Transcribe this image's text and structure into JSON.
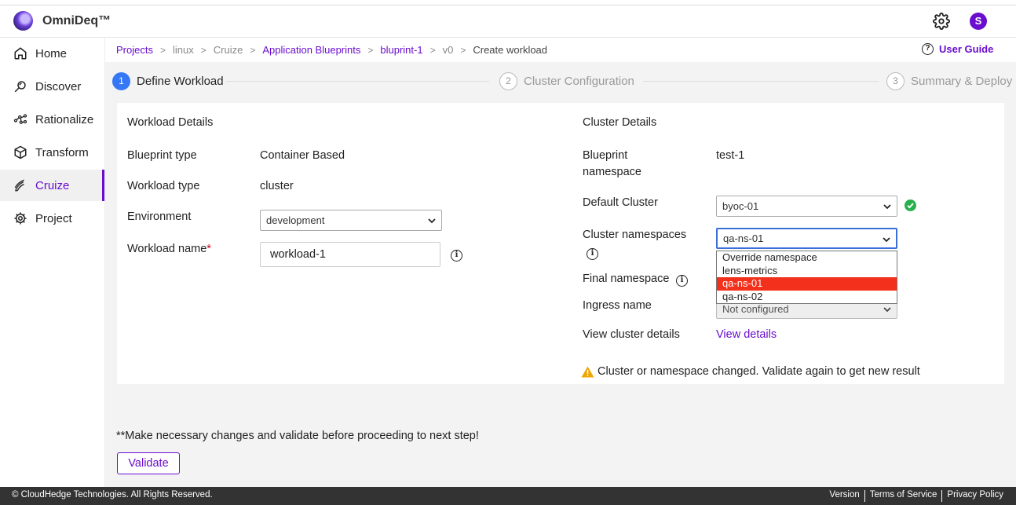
{
  "app": {
    "brand": "OmniDeq™",
    "avatar_initial": "S",
    "accent": "#6a0dce"
  },
  "sidebar": {
    "items": [
      {
        "label": "Home",
        "icon": "home-icon"
      },
      {
        "label": "Discover",
        "icon": "discover-icon"
      },
      {
        "label": "Rationalize",
        "icon": "rationalize-icon"
      },
      {
        "label": "Transform",
        "icon": "cube-icon"
      },
      {
        "label": "Cruize",
        "icon": "cruize-icon",
        "active": true
      },
      {
        "label": "Project",
        "icon": "gear-icon"
      }
    ]
  },
  "breadcrumb": {
    "items": [
      "Projects",
      "linux",
      "Cruize",
      "Application Blueprints",
      "bluprint-1",
      "v0",
      "Create workload"
    ],
    "separator": ">"
  },
  "user_guide": {
    "label": "User Guide",
    "icon_glyph": "?"
  },
  "stepper": {
    "steps": [
      {
        "num": "1",
        "label": "Define Workload",
        "state": "active"
      },
      {
        "num": "2",
        "label": "Cluster Configuration",
        "state": "pending"
      },
      {
        "num": "3",
        "label": "Summary & Deploy",
        "state": "pending"
      }
    ]
  },
  "workload": {
    "title": "Workload Details",
    "blueprint_type_label": "Blueprint type",
    "blueprint_type_value": "Container Based",
    "workload_type_label": "Workload type",
    "workload_type_value": "cluster",
    "environment_label": "Environment",
    "environment_value": "development",
    "workload_name_label": "Workload name",
    "workload_name_required": "*",
    "workload_name_value": "workload-1"
  },
  "cluster": {
    "title": "Cluster Details",
    "blueprint_ns_label_line1": "Blueprint",
    "blueprint_ns_label_line2": "namespace",
    "blueprint_ns_value": "test-1",
    "default_cluster_label": "Default Cluster",
    "default_cluster_value": "byoc-01",
    "cluster_ns_label": "Cluster namespaces",
    "cluster_ns_value": "qa-ns-01",
    "cluster_ns_options": [
      "Override namespace",
      "lens-metrics",
      "qa-ns-01",
      "qa-ns-02"
    ],
    "cluster_ns_selected_index": 2,
    "final_ns_label": "Final namespace",
    "ingress_label": "Ingress name",
    "ingress_value": "Not configured",
    "view_details_label": "View cluster details",
    "view_details_link": "View details",
    "warning": "Cluster or namespace changed. Validate again to get new result"
  },
  "note": "**Make necessary changes and validate before proceeding to next step!",
  "validate_button": "Validate",
  "footer": {
    "copyright": "© CloudHedge Technologies. All Rights Reserved.",
    "links": [
      "Version",
      "Terms of Service",
      "Privacy Policy"
    ]
  },
  "colors": {
    "step_active": "#3578f6",
    "success": "#27b04c",
    "warning": "#f0a500",
    "option_selected": "#f2301b"
  }
}
